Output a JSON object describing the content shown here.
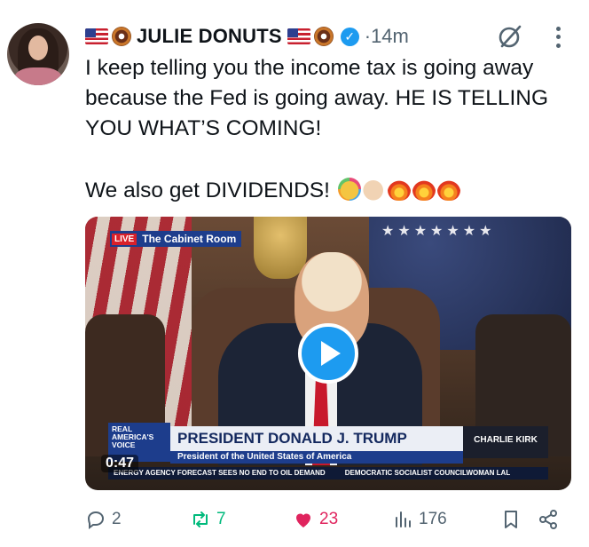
{
  "tweet": {
    "author": {
      "display_name": "JULIE DONUTS",
      "verified": true,
      "avatar_icon": "avatar"
    },
    "timestamp": "·14m",
    "text_line_1": "I keep telling you the income tax is going away because the Fed is going away. HE IS TELLING YOU WHAT’S COMING!",
    "text_line_2": "We also get DIVIDENDS!",
    "emojis": [
      "party-face",
      "clapping-hands",
      "fire",
      "fire",
      "fire"
    ]
  },
  "video": {
    "live_label": "LIVE",
    "location": "The Cabinet Room",
    "network_logo": "REAL AMERICA'S VOICE",
    "nameplate": "PRESIDENT DONALD J. TRUMP",
    "subtitle": "President of the United States of America",
    "show_logo": "CHARLIE KIRK",
    "ticker_left": "ENERGY AGENCY FORECAST SEES NO END TO OIL DEMAND",
    "ticker_right": "DEMOCRATIC SOCIALIST COUNCILWOMAN LAL",
    "duration": "0:47",
    "play_icon": "play-icon"
  },
  "actions": {
    "replies": "2",
    "reposts": "7",
    "likes": "23",
    "views": "176"
  },
  "colors": {
    "accent": "#1d9bf0",
    "like": "#e0245e",
    "repost": "#00ba7c",
    "muted": "#536471"
  }
}
